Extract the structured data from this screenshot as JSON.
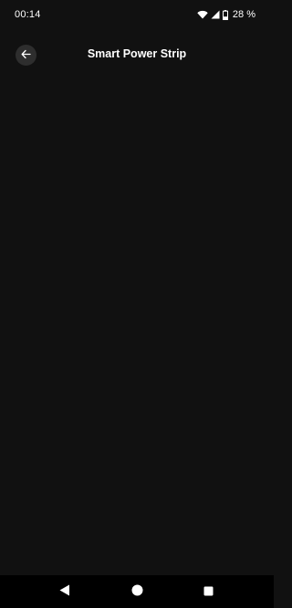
{
  "status_bar": {
    "time": "00:14",
    "battery_text": "28 %",
    "icons": [
      "wifi-icon",
      "cell-signal-icon",
      "battery-icon"
    ]
  },
  "app_bar": {
    "title": "Smart Power Strip",
    "back_icon": "arrow-left-icon"
  },
  "nav_bar": {
    "icons": [
      "nav-back-icon",
      "nav-home-icon",
      "nav-recents-icon"
    ]
  },
  "colors": {
    "background": "#111111",
    "nav_background": "#000000",
    "back_button_bg": "#2e2e2e",
    "text": "#ffffff"
  }
}
